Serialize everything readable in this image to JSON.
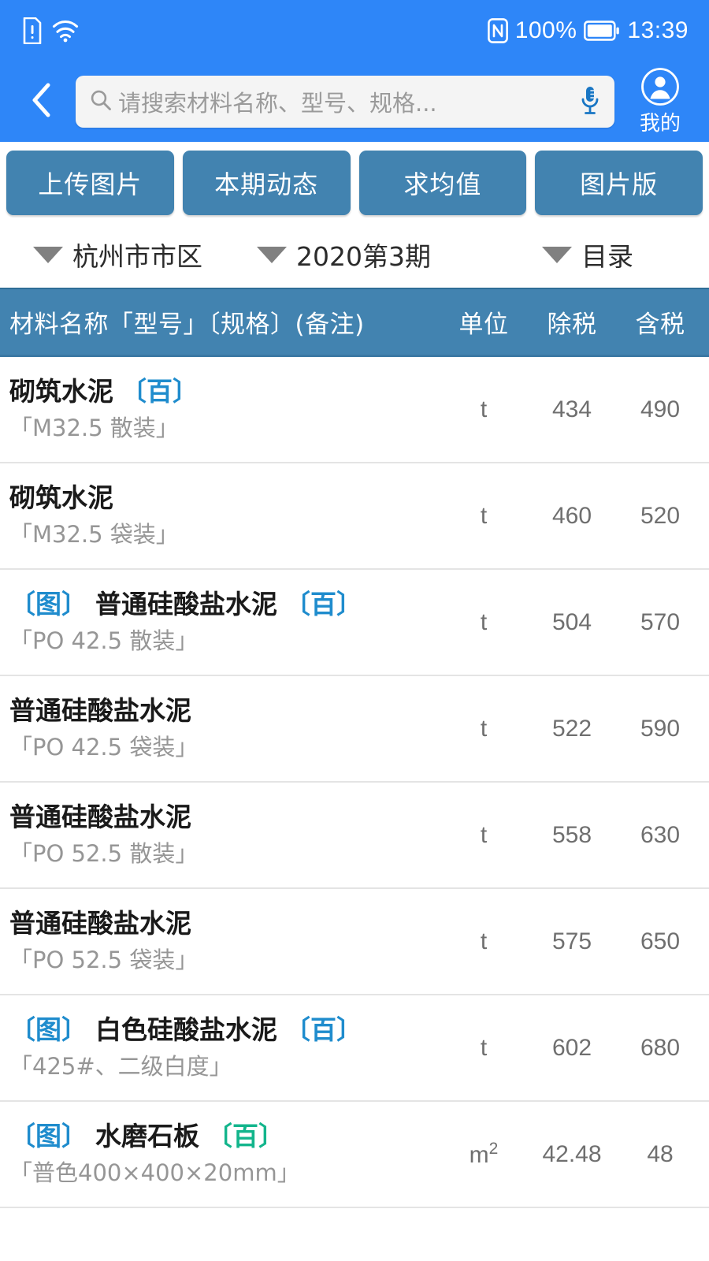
{
  "status_bar": {
    "icons_left": [
      "sim-alert-icon",
      "wifi-icon"
    ],
    "nfc_icon": "nfc-icon",
    "battery_percent": "100%",
    "battery_icon": "battery-full-icon",
    "time": "13:39"
  },
  "search": {
    "back_icon": "chevron-left-icon",
    "search_icon": "search-icon",
    "placeholder": "请搜索材料名称、型号、规格...",
    "value": "",
    "mic_icon": "microphone-icon",
    "profile_icon": "user-circle-icon",
    "profile_label": "我的"
  },
  "actions": [
    {
      "label": "上传图片",
      "name": "upload-image-button"
    },
    {
      "label": "本期动态",
      "name": "current-period-trends-button"
    },
    {
      "label": "求均值",
      "name": "average-button"
    },
    {
      "label": "图片版",
      "name": "image-version-button"
    }
  ],
  "filters": [
    {
      "label": "杭州市市区",
      "name": "filter-region"
    },
    {
      "label": "2020第3期",
      "name": "filter-period"
    },
    {
      "label": "目录",
      "name": "filter-catalog"
    }
  ],
  "table": {
    "headers": {
      "name": "材料名称「型号」〔规格〕(备注)",
      "unit": "单位",
      "excl_tax": "除税",
      "incl_tax": "含税"
    },
    "rows": [
      {
        "img_tag": "",
        "name": "砌筑水泥",
        "bai_tag": "〔百〕",
        "bai_color": "blue",
        "spec": "「M32.5 散装」",
        "unit": "t",
        "excl_tax": "434",
        "incl_tax": "490"
      },
      {
        "img_tag": "",
        "name": "砌筑水泥",
        "bai_tag": "",
        "bai_color": "",
        "spec": "「M32.5 袋装」",
        "unit": "t",
        "excl_tax": "460",
        "incl_tax": "520"
      },
      {
        "img_tag": "〔图〕",
        "name": "普通硅酸盐水泥",
        "bai_tag": "〔百〕",
        "bai_color": "blue",
        "spec": "「PO 42.5 散装」",
        "unit": "t",
        "excl_tax": "504",
        "incl_tax": "570"
      },
      {
        "img_tag": "",
        "name": "普通硅酸盐水泥",
        "bai_tag": "",
        "bai_color": "",
        "spec": "「PO 42.5 袋装」",
        "unit": "t",
        "excl_tax": "522",
        "incl_tax": "590"
      },
      {
        "img_tag": "",
        "name": "普通硅酸盐水泥",
        "bai_tag": "",
        "bai_color": "",
        "spec": "「PO 52.5 散装」",
        "unit": "t",
        "excl_tax": "558",
        "incl_tax": "630"
      },
      {
        "img_tag": "",
        "name": "普通硅酸盐水泥",
        "bai_tag": "",
        "bai_color": "",
        "spec": "「PO 52.5 袋装」",
        "unit": "t",
        "excl_tax": "575",
        "incl_tax": "650"
      },
      {
        "img_tag": "〔图〕",
        "name": "白色硅酸盐水泥",
        "bai_tag": "〔百〕",
        "bai_color": "blue",
        "spec": "「425#、二级白度」",
        "unit": "t",
        "excl_tax": "602",
        "incl_tax": "680"
      },
      {
        "img_tag": "〔图〕",
        "name": "水磨石板",
        "bai_tag": "〔百〕",
        "bai_color": "green",
        "spec": "「普色400×400×20mm」",
        "unit": "m²",
        "excl_tax": "42.48",
        "incl_tax": "48"
      }
    ]
  },
  "colors": {
    "status_blue": "#2e86f8",
    "header_steel": "#4283b0",
    "button_steel": "#4283b0",
    "tag_blue": "#1f8ccd",
    "tag_green": "#13b58c",
    "spec_gray": "#969696",
    "value_gray": "#6f6f6f"
  }
}
